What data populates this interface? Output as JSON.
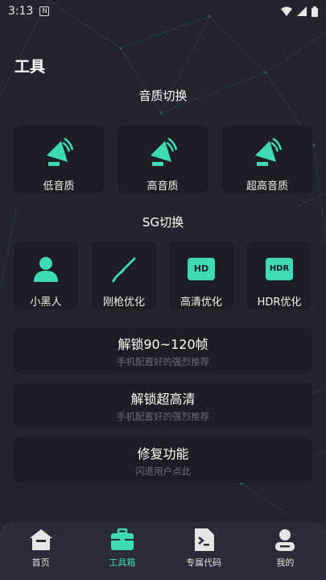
{
  "status_bar": {
    "time": "3:13",
    "notification_glyph": "N"
  },
  "page": {
    "title": "工具"
  },
  "sound_section": {
    "title": "音质切换",
    "items": [
      {
        "label": "低音质",
        "icon": "speaker-icon"
      },
      {
        "label": "高音质",
        "icon": "speaker-icon"
      },
      {
        "label": "超高音质",
        "icon": "speaker-icon"
      }
    ]
  },
  "sg_section": {
    "title": "SG切换",
    "items": [
      {
        "label": "小黑人",
        "icon": "person-icon"
      },
      {
        "label": "刚枪优化",
        "icon": "rifle-icon"
      },
      {
        "label": "高清优化",
        "icon": "hd-icon",
        "badge": "HD"
      },
      {
        "label": "HDR优化",
        "icon": "hdr-icon",
        "badge": "HDR"
      }
    ]
  },
  "actions": [
    {
      "title": "解锁90~120帧",
      "subtitle": "手机配置好的强烈推荐"
    },
    {
      "title": "解锁超高清",
      "subtitle": "手机配置好的强烈推荐"
    },
    {
      "title": "修复功能",
      "subtitle": "闪退用户点此"
    }
  ],
  "tabs": [
    {
      "label": "首页",
      "icon": "home-icon"
    },
    {
      "label": "工具箱",
      "icon": "toolbox-icon",
      "active": true
    },
    {
      "label": "专属代码",
      "icon": "terminal-icon"
    },
    {
      "label": "我的",
      "icon": "user-icon"
    }
  ],
  "colors": {
    "accent": "#3ddab4",
    "background": "#23242e",
    "card": "#1c1d25",
    "tabbar": "#2b2c37"
  }
}
